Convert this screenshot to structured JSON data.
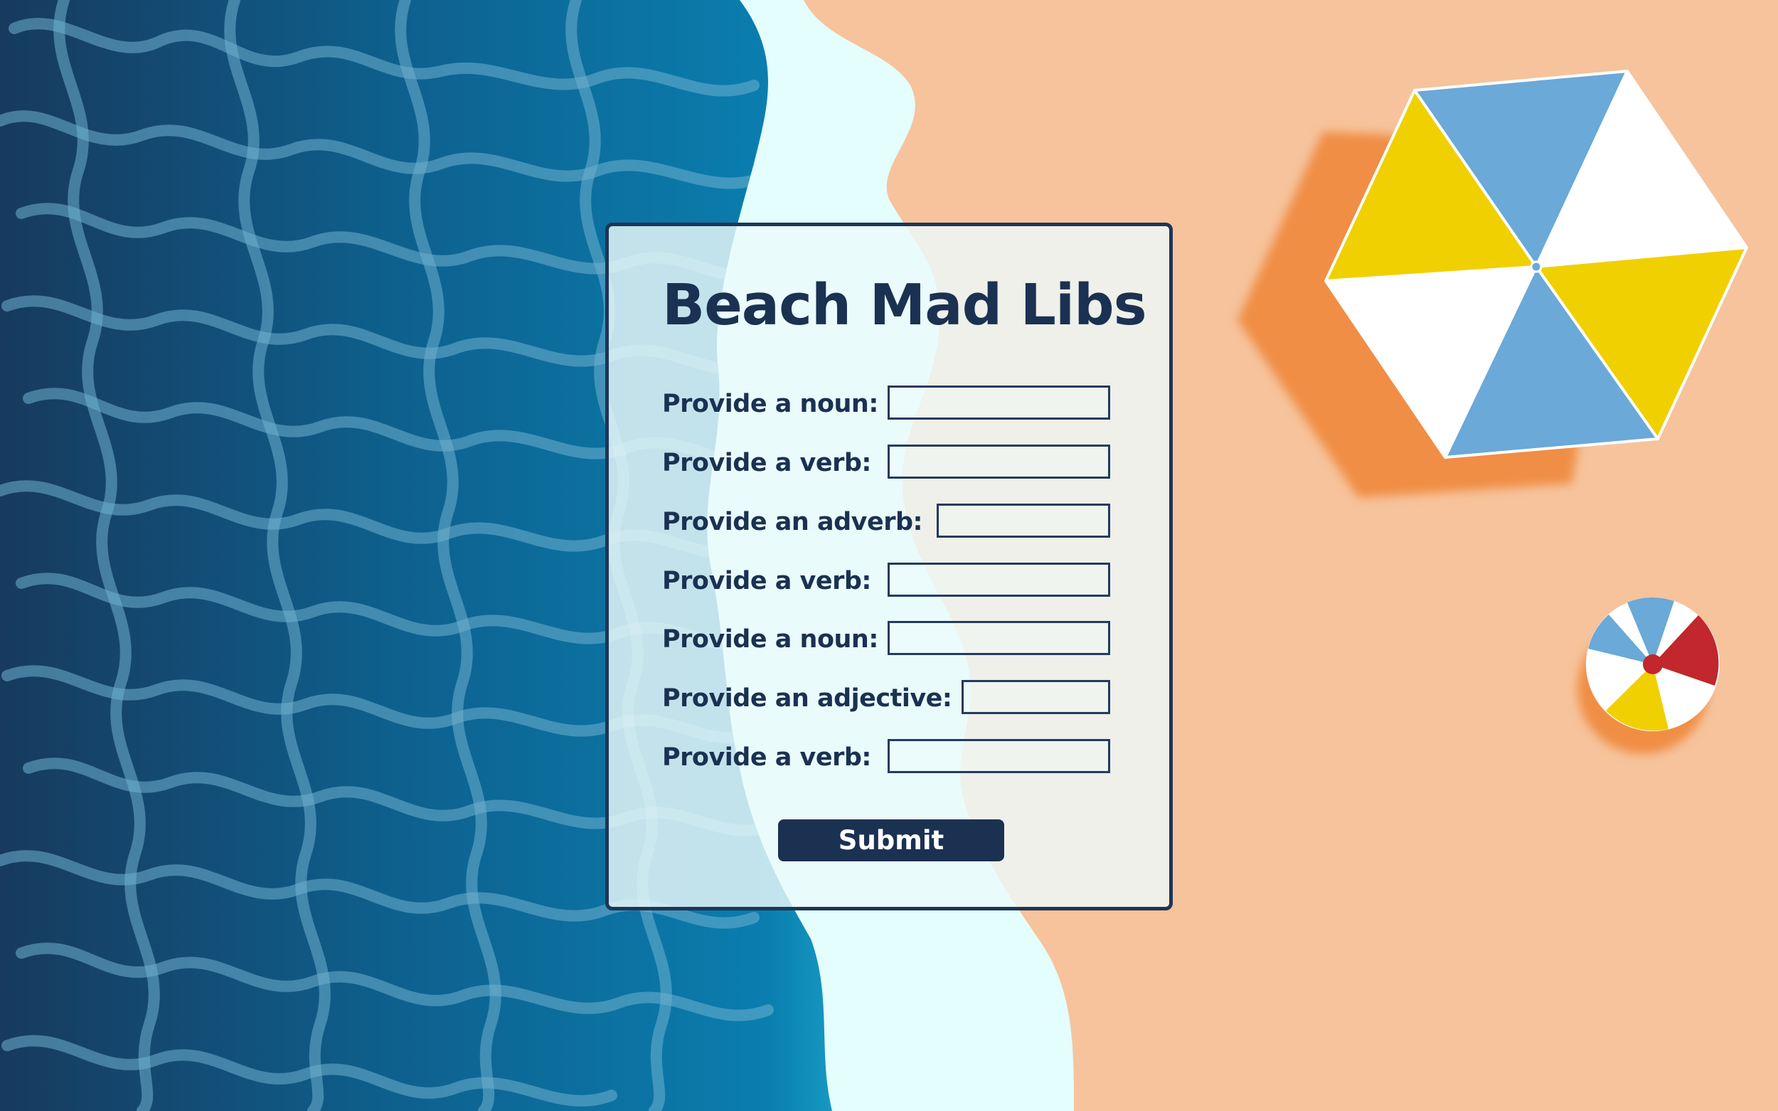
{
  "colors": {
    "sand": "#f6c39c",
    "shadow": "#f08e45",
    "foam": "#e4fdfd",
    "ocean_deep": "#173a5e",
    "ocean_mid": "#0b6a95",
    "ocean_light": "#1998c2",
    "navy": "#1b3152",
    "umbrella_blue": "#6aa9d8",
    "umbrella_yellow": "#f0d000",
    "ball_red": "#c1272d"
  },
  "form": {
    "title": "Beach Mad Libs",
    "fields": [
      {
        "label": "Provide a noun:",
        "value": ""
      },
      {
        "label": "Provide a verb:",
        "value": ""
      },
      {
        "label": "Provide an adverb:",
        "value": ""
      },
      {
        "label": "Provide a verb:",
        "value": ""
      },
      {
        "label": "Provide a noun:",
        "value": ""
      },
      {
        "label": "Provide an adjective:",
        "value": ""
      },
      {
        "label": "Provide a verb:",
        "value": ""
      }
    ],
    "submit_label": "Submit"
  },
  "decorations": {
    "umbrella_icon": "beach-umbrella-icon",
    "ball_icon": "beach-ball-icon"
  }
}
